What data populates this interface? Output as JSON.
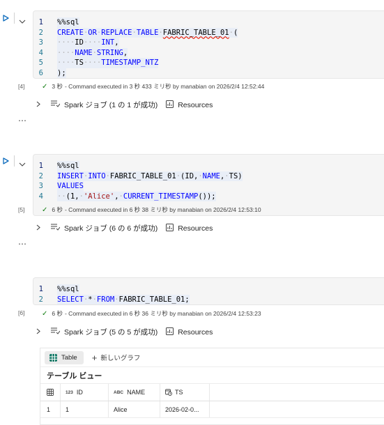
{
  "colors": {
    "run_icon": "#0f6cbd",
    "success": "#107c10",
    "keyword": "#0000ff",
    "string": "#a31515",
    "line_number": "#237893"
  },
  "cells": [
    {
      "count": "[4]",
      "lines": [
        {
          "n": "1",
          "parts": [
            {
              "t": "%%sql",
              "c": "tx"
            }
          ]
        },
        {
          "n": "2",
          "parts": [
            {
              "t": "CREATE",
              "c": "kw"
            },
            {
              "t": "·",
              "c": "dot"
            },
            {
              "t": "OR",
              "c": "kw"
            },
            {
              "t": "·",
              "c": "dot"
            },
            {
              "t": "REPLACE",
              "c": "kw"
            },
            {
              "t": "·",
              "c": "dot"
            },
            {
              "t": "TABLE",
              "c": "kw"
            },
            {
              "t": "·",
              "c": "dot"
            },
            {
              "t": "FABRIC_TABLE_01",
              "c": "tx squig"
            },
            {
              "t": "·",
              "c": "dot"
            },
            {
              "t": "(",
              "c": "tx"
            }
          ]
        },
        {
          "n": "3",
          "parts": [
            {
              "t": "····",
              "c": "dot"
            },
            {
              "t": "ID",
              "c": "tx"
            },
            {
              "t": "····",
              "c": "dot"
            },
            {
              "t": "INT",
              "c": "kw"
            },
            {
              "t": ",",
              "c": "tx"
            }
          ]
        },
        {
          "n": "4",
          "parts": [
            {
              "t": "····",
              "c": "dot"
            },
            {
              "t": "NAME",
              "c": "kw"
            },
            {
              "t": "·",
              "c": "dot"
            },
            {
              "t": "STRING",
              "c": "kw"
            },
            {
              "t": ",",
              "c": "tx"
            }
          ]
        },
        {
          "n": "5",
          "parts": [
            {
              "t": "····",
              "c": "dot"
            },
            {
              "t": "TS",
              "c": "tx"
            },
            {
              "t": "····",
              "c": "dot"
            },
            {
              "t": "TIMESTAMP_NTZ",
              "c": "kw"
            }
          ]
        },
        {
          "n": "6",
          "parts": [
            {
              "t": ");",
              "c": "tx"
            }
          ]
        }
      ],
      "duration": "3 秒",
      "status_text": "- Command executed in 3 秒 433 ミリ秒 by manabian on 2026/2/4 12:52:44",
      "spark": "Spark ジョブ (1 の 1 が成功)",
      "resources": "Resources"
    },
    {
      "count": "[5]",
      "lines": [
        {
          "n": "1",
          "parts": [
            {
              "t": "%%sql",
              "c": "tx"
            }
          ]
        },
        {
          "n": "2",
          "parts": [
            {
              "t": "INSERT",
              "c": "kw"
            },
            {
              "t": "·",
              "c": "dot"
            },
            {
              "t": "INTO",
              "c": "kw"
            },
            {
              "t": "·",
              "c": "dot"
            },
            {
              "t": "FABRIC_TABLE_01",
              "c": "tx"
            },
            {
              "t": "·",
              "c": "dot"
            },
            {
              "t": "(ID,",
              "c": "tx"
            },
            {
              "t": "·",
              "c": "dot"
            },
            {
              "t": "NAME",
              "c": "kw"
            },
            {
              "t": ",",
              "c": "tx"
            },
            {
              "t": "·",
              "c": "dot"
            },
            {
              "t": "TS)",
              "c": "tx"
            }
          ]
        },
        {
          "n": "3",
          "parts": [
            {
              "t": "VALUES",
              "c": "kw"
            }
          ]
        },
        {
          "n": "4",
          "parts": [
            {
              "t": "··",
              "c": "dot"
            },
            {
              "t": "(1,",
              "c": "tx"
            },
            {
              "t": "·",
              "c": "dot"
            },
            {
              "t": "'Alice'",
              "c": "st"
            },
            {
              "t": ",",
              "c": "tx"
            },
            {
              "t": "·",
              "c": "dot"
            },
            {
              "t": "CURRENT_TIMESTAMP",
              "c": "kw"
            },
            {
              "t": "());",
              "c": "tx"
            }
          ]
        }
      ],
      "duration": "6 秒",
      "status_text": "- Command executed in 6 秒 38 ミリ秒 by manabian on 2026/2/4 12:53:10",
      "spark": "Spark ジョブ (6 の 6 が成功)",
      "resources": "Resources"
    },
    {
      "count": "[6]",
      "lines": [
        {
          "n": "1",
          "parts": [
            {
              "t": "%%sql",
              "c": "tx"
            }
          ]
        },
        {
          "n": "2",
          "parts": [
            {
              "t": "SELECT",
              "c": "kw"
            },
            {
              "t": "·",
              "c": "dot"
            },
            {
              "t": "*",
              "c": "tx"
            },
            {
              "t": "·",
              "c": "dot"
            },
            {
              "t": "FROM",
              "c": "kw"
            },
            {
              "t": "·",
              "c": "dot"
            },
            {
              "t": "FABRIC_TABLE_01;",
              "c": "tx"
            }
          ]
        }
      ],
      "duration": "6 秒",
      "status_text": "- Command executed in 6 秒 36 ミリ秒 by manabian on 2026/2/4 12:53:23",
      "spark": "Spark ジョブ (5 の 5 が成功)",
      "resources": "Resources"
    }
  ],
  "more": "⋯",
  "result": {
    "tab_table": "Table",
    "tab_new_chart": "新しいグラフ",
    "title": "テーブル ビュー",
    "columns": [
      {
        "type": "123",
        "name": "ID"
      },
      {
        "type": "ABC",
        "name": "NAME"
      },
      {
        "type": "",
        "name": "TS"
      }
    ],
    "rows": [
      {
        "idx": "1",
        "id": "1",
        "name": "Alice",
        "ts": "2026-02-0..."
      }
    ]
  }
}
